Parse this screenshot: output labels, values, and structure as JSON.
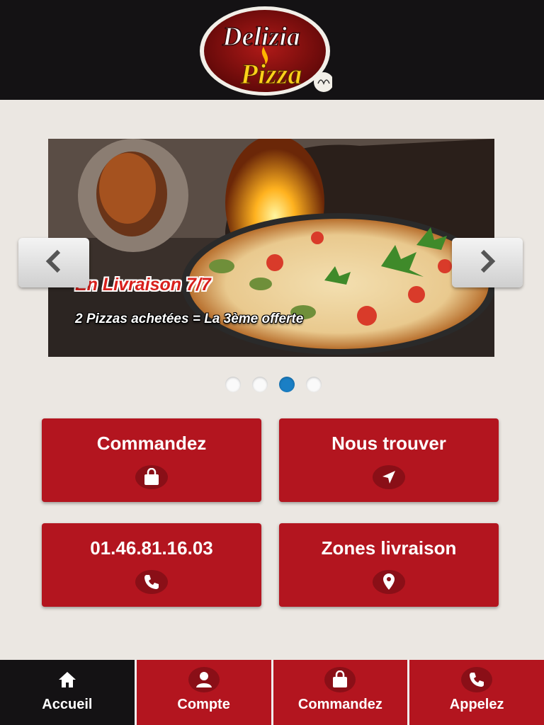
{
  "header": {
    "logo_line1": "Delizia",
    "logo_line2": "Pizza",
    "logo_alt": "Delizia Pizza logo"
  },
  "slider": {
    "headline": "En Livraison 7/7",
    "offer": "2 Pizzas achetées = La 3ème offerte",
    "prev_icon": "chevron-left-icon",
    "next_icon": "chevron-right-icon",
    "dot_count": 4,
    "active_dot": 3
  },
  "tiles": [
    {
      "label": "Commandez",
      "icon": "shopping-bag-icon"
    },
    {
      "label": "Nous trouver",
      "icon": "navigation-arrow-icon"
    },
    {
      "label": "01.46.81.16.03",
      "icon": "phone-icon"
    },
    {
      "label": "Zones livraison",
      "icon": "map-pin-icon"
    }
  ],
  "bottom_nav": {
    "items": [
      {
        "label": "Accueil",
        "icon": "home-icon",
        "active": true
      },
      {
        "label": "Compte",
        "icon": "user-icon",
        "active": false
      },
      {
        "label": "Commandez",
        "icon": "shopping-bag-icon",
        "active": false
      },
      {
        "label": "Appelez",
        "icon": "phone-icon",
        "active": false
      }
    ]
  },
  "colors": {
    "header_bg": "#141214",
    "brand_red": "#b3151f",
    "page_bg": "#ebe7e2",
    "active_dot": "#1a7fc5"
  }
}
